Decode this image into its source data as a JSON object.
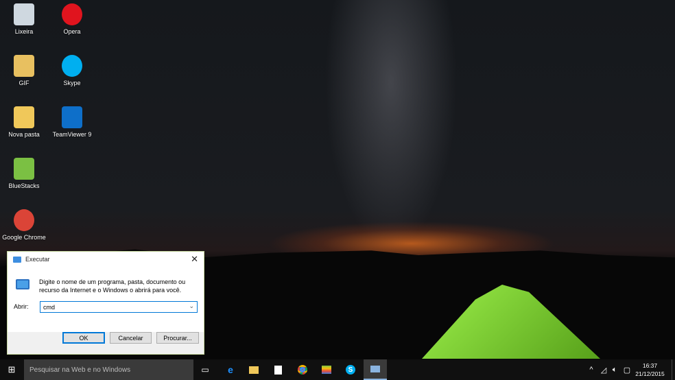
{
  "desktop": {
    "icons": [
      {
        "label": "Lixeira",
        "icon": "recycle-bin-icon",
        "color": "#cfd8e0"
      },
      {
        "label": "Opera",
        "icon": "opera-icon",
        "color": "#e0141e"
      },
      {
        "label": "GIF",
        "icon": "folder-icon",
        "color": "#e8c060"
      },
      {
        "label": "Skype",
        "icon": "skype-icon",
        "color": "#00aff0"
      },
      {
        "label": "Nova pasta",
        "icon": "folder-icon",
        "color": "#f0c85a"
      },
      {
        "label": "TeamViewer 9",
        "icon": "teamviewer-icon",
        "color": "#0e6fc9"
      },
      {
        "label": "BlueStacks",
        "icon": "bluestacks-icon",
        "color": "#7bc043"
      },
      {
        "label": "Google Chrome",
        "icon": "chrome-icon",
        "color": "#db4437"
      }
    ]
  },
  "run_dialog": {
    "title": "Executar",
    "description": "Digite o nome de um programa, pasta, documento ou recurso da Internet e o Windows o abrirá para você.",
    "open_label": "Abrir:",
    "input_value": "cmd",
    "ok": "OK",
    "cancel": "Cancelar",
    "browse": "Procurar..."
  },
  "taskbar": {
    "search_placeholder": "Pesquisar na Web e no Windows",
    "time": "16:37",
    "date": "21/12/2015"
  }
}
